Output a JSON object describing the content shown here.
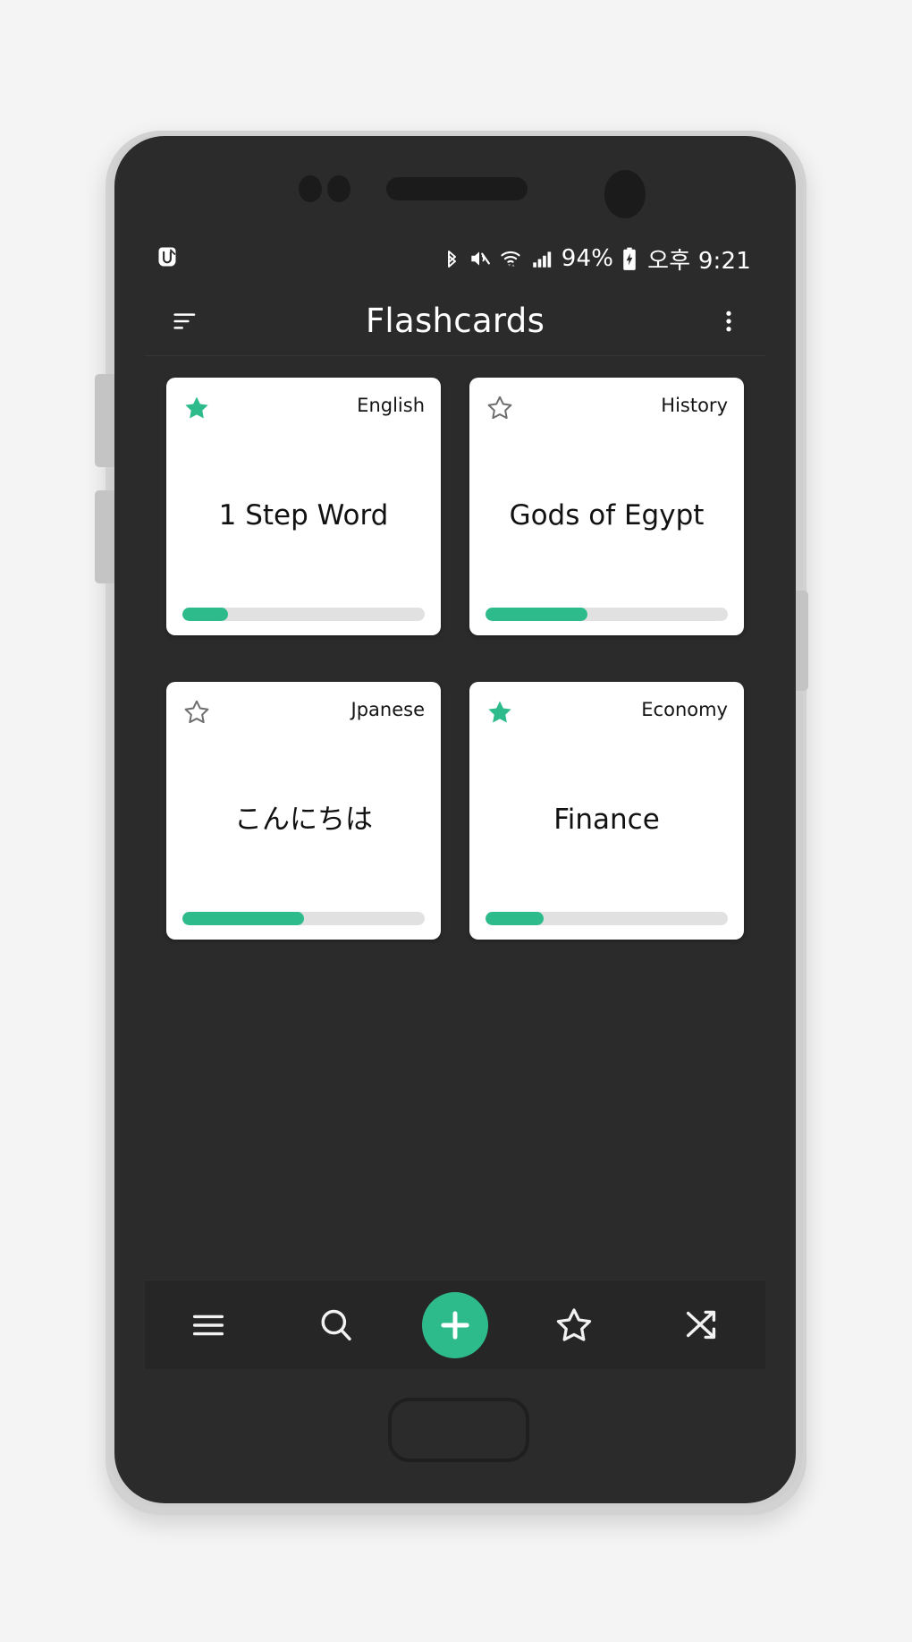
{
  "device": {
    "frame_color": "#d2d2d2",
    "body_color": "#2b2b2b"
  },
  "status_bar": {
    "app_notification_icon": "app-logo-icon",
    "icons": [
      "bluetooth-icon",
      "mute-icon",
      "wifi-icon",
      "cellular-signal-icon",
      "battery-charging-icon"
    ],
    "battery_percent": "94%",
    "clock": "오후 9:21"
  },
  "app_bar": {
    "sort_icon": "sort-icon",
    "title": "Flashcards",
    "overflow_icon": "overflow-menu-icon"
  },
  "theme": {
    "accent": "#2ebb8c",
    "screen_bg": "#2b2b2b",
    "card_bg": "#ffffff",
    "progress_track": "#e1e1e1"
  },
  "cards": [
    {
      "title": "1 Step Word",
      "category": "English",
      "starred": true,
      "star_icon": "star-filled-icon",
      "progress": 19
    },
    {
      "title": "Gods of Egypt",
      "category": "History",
      "starred": false,
      "star_icon": "star-outline-icon",
      "progress": 42
    },
    {
      "title": "こんにちは",
      "category": "Jpanese",
      "starred": false,
      "star_icon": "star-outline-icon",
      "progress": 50
    },
    {
      "title": "Finance",
      "category": "Economy",
      "starred": true,
      "star_icon": "star-filled-icon",
      "progress": 24
    }
  ],
  "bottom_nav": {
    "items": [
      {
        "name": "menu",
        "icon": "hamburger-menu-icon"
      },
      {
        "name": "search",
        "icon": "search-icon"
      },
      {
        "name": "add",
        "icon": "plus-icon"
      },
      {
        "name": "favorites",
        "icon": "star-outline-icon"
      },
      {
        "name": "shuffle",
        "icon": "shuffle-icon"
      }
    ]
  }
}
